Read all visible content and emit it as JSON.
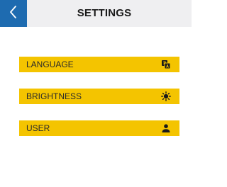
{
  "header": {
    "title": "SETTINGS",
    "back_icon": "chevron-left-icon"
  },
  "menu": {
    "items": [
      {
        "label": "LANGUAGE",
        "icon": "translate-icon"
      },
      {
        "label": "BRIGHTNESS",
        "icon": "sun-icon"
      },
      {
        "label": "USER",
        "icon": "user-icon"
      }
    ]
  },
  "colors": {
    "accent": "#1e6bb0",
    "header_bg": "#efeff1",
    "item_bg": "#f4c400",
    "text": "#1a1a1a"
  }
}
